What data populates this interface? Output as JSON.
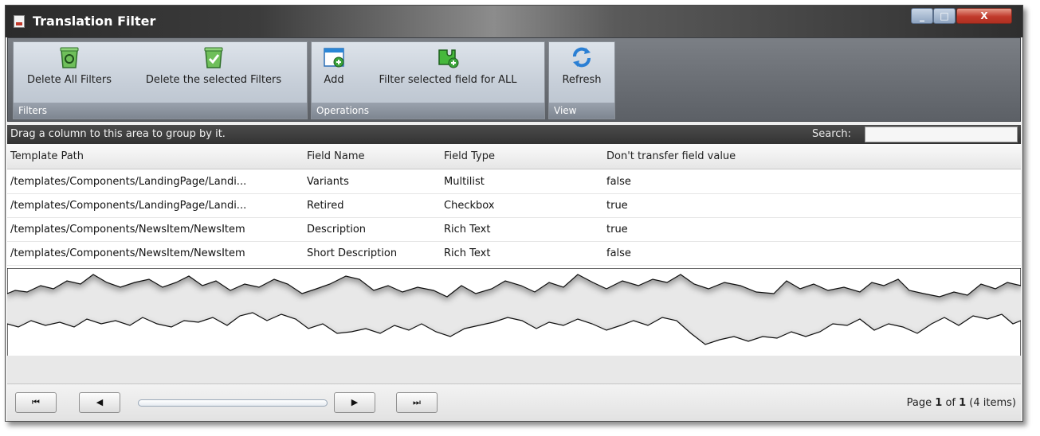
{
  "window": {
    "title": "Translation Filter",
    "controls": {
      "minimize": "_",
      "maximize": "□",
      "close": "X"
    }
  },
  "ribbon": {
    "groups": [
      {
        "label": "Filters",
        "buttons": [
          {
            "label": "Delete All Filters",
            "icon": "recycle-bin-icon"
          },
          {
            "label": "Delete the selected Filters",
            "icon": "recycle-bin-check-icon"
          }
        ]
      },
      {
        "label": "Operations",
        "buttons": [
          {
            "label": "Add",
            "icon": "window-add-icon"
          },
          {
            "label": "Filter selected field for ALL",
            "icon": "puzzle-add-icon"
          }
        ]
      },
      {
        "label": "View",
        "buttons": [
          {
            "label": "Refresh",
            "icon": "refresh-icon"
          }
        ]
      }
    ]
  },
  "grid": {
    "group_hint": "Drag a column to this area to group by it.",
    "search_label": "Search:",
    "search_value": "",
    "columns": [
      "Template Path",
      "Field Name",
      "Field Type",
      "Don't transfer field value"
    ],
    "rows": [
      [
        "/templates/Components/LandingPage/Landi...",
        "Variants",
        "Multilist",
        "false"
      ],
      [
        "/templates/Components/LandingPage/Landi...",
        "Retired",
        "Checkbox",
        "true"
      ],
      [
        "/templates/Components/NewsItem/NewsItem",
        "Description",
        "Rich Text",
        "true"
      ],
      [
        "/templates/Components/NewsItem/NewsItem",
        "Short Description",
        "Rich Text",
        "false"
      ]
    ]
  },
  "pager": {
    "first": "⏮",
    "prev": "◀",
    "next": "▶",
    "last": "⏭",
    "page_prefix": "Page ",
    "page_current": "1",
    "page_of": " of ",
    "page_total": "1",
    "item_count": " (4 items)"
  },
  "colors": {
    "titlebar": "#2b2b2b",
    "ribbon_group": "#c6ced8",
    "group_bar": "#3c3c3c",
    "close_button": "#c0392b"
  }
}
